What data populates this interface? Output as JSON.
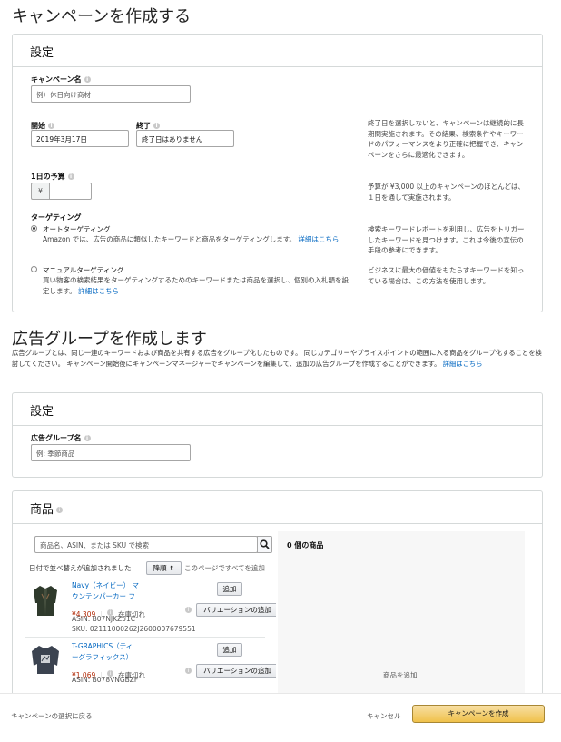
{
  "page_title": "キャンペーンを作成する",
  "settings": {
    "heading": "設定",
    "campaign_name_label": "キャンペーン名",
    "campaign_name_placeholder": "例）休日向け商材",
    "start_label": "開始",
    "start_value": "2019年3月17日",
    "end_label": "終了",
    "end_value": "終了日はありません",
    "date_help": "終了日を選択しないと、キャンペーンは継続的に長期間実施されます。その結果、検索条件やキーワードのパフォーマンスをより正確に把握でき、キャンペーンをさらに最適化できます。",
    "budget_label": "1日の予算",
    "budget_currency": "¥",
    "budget_help": "予算が ¥3,000 以上のキャンペーンのほとんどは、１日を通して実施されます。",
    "targeting_label": "ターゲティング",
    "auto_title": "オートターゲティング",
    "auto_desc": "Amazon では、広告の商品に類似したキーワードと商品をターゲティングします。",
    "auto_link": "詳細はこちら",
    "auto_help": "検索キーワードレポートを利用し、広告をトリガーしたキーワードを見つけます。これは今後の宣伝の手段の参考にできます。",
    "manual_title": "マニュアルターゲティング",
    "manual_desc": "買い物客の検索結果をターゲティングするためのキーワードまたは商品を選択し、個別の入札額を設定します。",
    "manual_link": "詳細はこちら",
    "manual_help": "ビジネスに最大の価値をもたらすキーワードを知っている場合は、この方法を使用します。"
  },
  "ad_group": {
    "heading": "広告グループを作成します",
    "description": "広告グループとは、同じ一連のキーワードおよび商品を共有する広告をグループ化したものです。 同じカテゴリーやプライスポイントの範囲に入る商品をグループ化することを検討してください。 キャンペーン開始後にキャンペーンマネージャーでキャンペーンを編集して、追加の広告グループを作成することができます。",
    "description_link": "詳細はこちら",
    "settings_heading": "設定",
    "name_label": "広告グループ名",
    "name_placeholder": "例: 季節商品"
  },
  "products": {
    "heading": "商品",
    "search_placeholder": "商品名、ASIN、または SKU で検索",
    "sort_label": "日付で並べ替えが追加されました",
    "sort_value": "降順",
    "add_all_link": "このページですべてを追加",
    "selected_count": "0 個の商品",
    "empty_text": "商品を追加",
    "items": [
      {
        "name_line1": "Navy（ネイビー） マ",
        "name_line2": "ウンテンパーカー フ",
        "price": "¥4,309",
        "stock": "在庫切れ",
        "asin": "ASIN: B07NJKZ51C",
        "sku": "SKU: 02111000262J2600007679551",
        "add_label": "追加",
        "variation_label": "バリエーションの追加"
      },
      {
        "name_line1": "T-GRAPHICS（ティ",
        "name_line2": "ーグラフィックス）",
        "price": "¥1,069",
        "stock": "在庫切れ",
        "asin": "ASIN: B078VNGBZF",
        "sku": "",
        "add_label": "追加",
        "variation_label": "バリエーションの追加"
      }
    ]
  },
  "footer": {
    "back_link": "キャンペーンの選択に戻る",
    "cancel": "キャンセル",
    "create": "キャンペーンを作成"
  },
  "colors": {
    "link": "#0066c0",
    "price": "#b12704",
    "primary_button": "#f0c14b"
  }
}
